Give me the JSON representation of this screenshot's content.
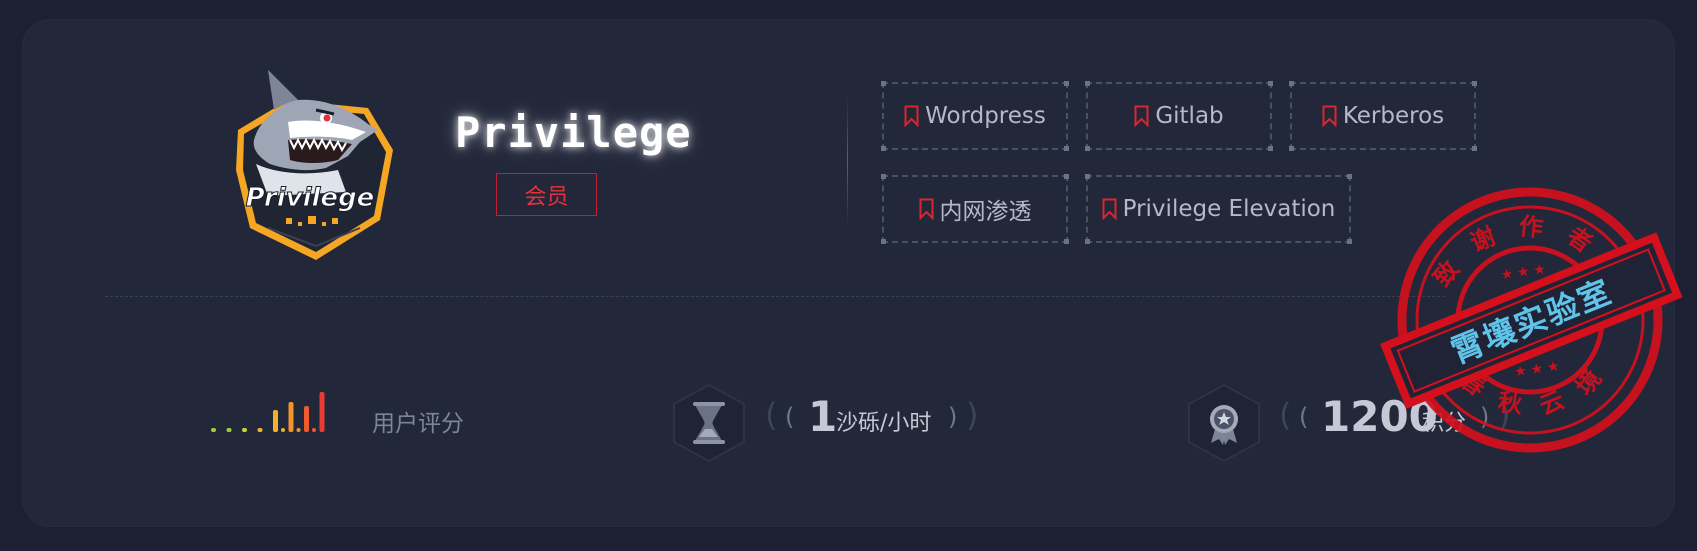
{
  "profile": {
    "name": "Privilege",
    "logo_text": "Privilege",
    "badge": "会员"
  },
  "tags": [
    {
      "label": "Wordpress",
      "icon": "bookmark-icon"
    },
    {
      "label": "Gitlab",
      "icon": "bookmark-icon"
    },
    {
      "label": "Kerberos",
      "icon": "bookmark-icon"
    },
    {
      "label": "内网渗透",
      "icon": "bookmark-icon"
    },
    {
      "label": "Privilege Elevation",
      "icon": "bookmark-icon"
    }
  ],
  "stats": {
    "rating_label": "用户评分",
    "rating_level": 8,
    "rating_max": 8,
    "rate_value": "1",
    "rate_unit": "沙砾/小时",
    "points_value": "1200",
    "points_unit": "积分"
  },
  "stamp": {
    "top_text": "致谢作者",
    "bottom_text": "春秋云境",
    "banner_text": "霄壤实验室"
  },
  "colors": {
    "accent_red": "#e2323e",
    "stamp_red": "#d4101c",
    "banner_cyan": "#5fc3ea",
    "rating_colors": [
      "#9bcf3b",
      "#c7d23a",
      "#f0b22a",
      "#f4932a",
      "#ef5b2e",
      "#ea3a35"
    ]
  }
}
